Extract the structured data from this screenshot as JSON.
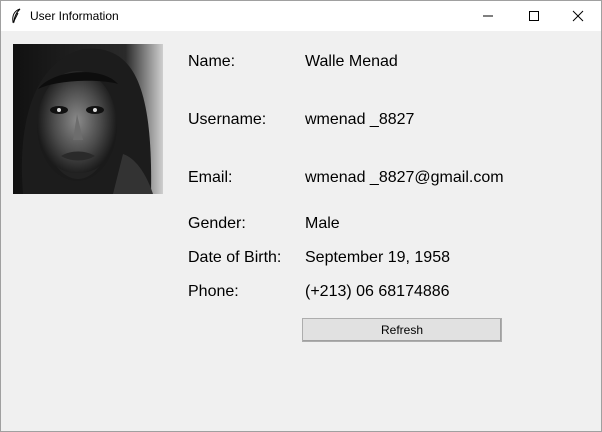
{
  "window": {
    "title": "User Information",
    "icon": "feather-icon",
    "controls": [
      "minimize-icon",
      "maximize-icon",
      "close-icon"
    ]
  },
  "profile": {
    "photo": "user-photo",
    "fields": [
      {
        "label": "Name:",
        "value": "Walle Menad"
      },
      {
        "label": "Username:",
        "value": "wmenad _8827"
      },
      {
        "label": "Email:",
        "value": "wmenad _8827@gmail.com"
      },
      {
        "label": "Gender:",
        "value": "Male"
      },
      {
        "label": "Date of Birth:",
        "value": "September 19, 1958"
      },
      {
        "label": "Phone:",
        "value": "(+213) 06 68174886"
      }
    ]
  },
  "actions": {
    "refresh_label": "Refresh"
  },
  "colors": {
    "window_bg": "#f0f0f0",
    "titlebar_bg": "#ffffff",
    "button_bg": "#e1e1e1",
    "button_border": "#adadad"
  }
}
